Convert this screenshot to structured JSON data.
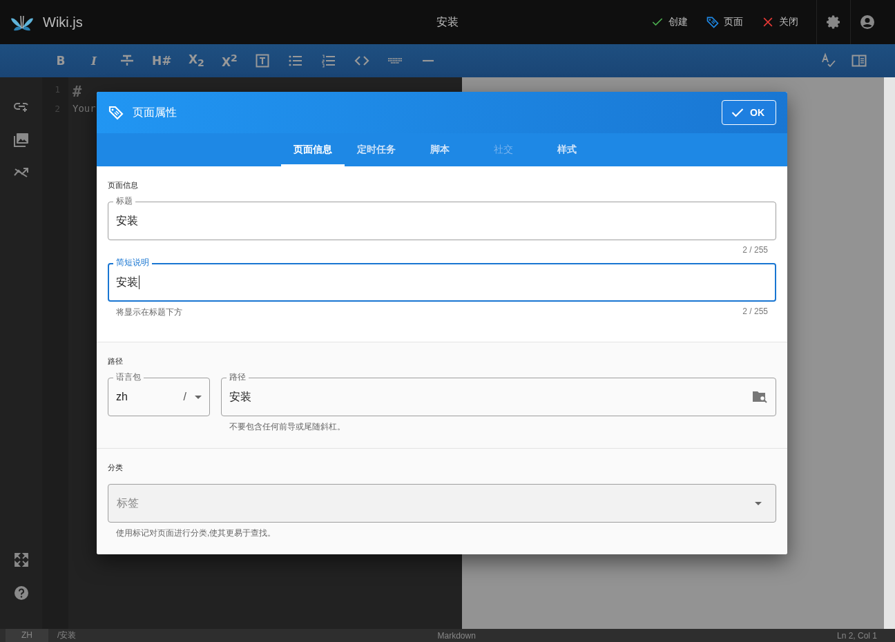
{
  "app_bar": {
    "logo_text": "Wiki.js",
    "title": "安装",
    "actions": [
      {
        "kind": "create",
        "label": "创建"
      },
      {
        "kind": "page",
        "label": "页面"
      },
      {
        "kind": "close",
        "label": "关闭"
      }
    ]
  },
  "toolbar": {
    "tools": [
      {
        "kind": "bold",
        "label": "B"
      },
      {
        "kind": "italic",
        "label": "I"
      },
      {
        "kind": "strike"
      },
      {
        "kind": "heading",
        "label": "H#"
      },
      {
        "kind": "subscript",
        "label": "X$_{2}$"
      },
      {
        "kind": "superscript",
        "label": "X$^{2}$"
      },
      {
        "kind": "box"
      },
      {
        "kind": "list"
      },
      {
        "kind": "olist"
      },
      {
        "kind": "code"
      },
      {
        "kind": "keyboard"
      },
      {
        "kind": "rule"
      }
    ]
  },
  "editor": {
    "line_numbers": [
      "1",
      "2"
    ],
    "lines": [
      "#",
      "Your"
    ]
  },
  "dialog": {
    "title": "页面属性",
    "ok_label": "OK",
    "tabs": [
      {
        "label": "页面信息",
        "selected": true,
        "disabled": false
      },
      {
        "label": "定时任务",
        "selected": false,
        "disabled": false
      },
      {
        "label": "脚本",
        "selected": false,
        "disabled": false
      },
      {
        "label": "社交",
        "selected": false,
        "disabled": true
      },
      {
        "label": "样式",
        "selected": false,
        "disabled": false
      }
    ],
    "info": {
      "heading": "页面信息",
      "title_field": {
        "label": "标题",
        "value": "安装",
        "counter": "2 / 255",
        "focused": false
      },
      "description_field": {
        "label": "简短说明",
        "value": "安装",
        "hint": "将显示在标题下方",
        "counter": "2 / 255",
        "focused": true
      }
    },
    "path": {
      "heading": "路径",
      "locale_field": {
        "label": "语言包",
        "value": "zh",
        "separator": "/"
      },
      "path_field": {
        "label": "路径",
        "value": "安装",
        "hint": "不要包含任何前导或尾随斜杠。"
      }
    },
    "categories": {
      "heading": "分类",
      "tags_field": {
        "placeholder": "标签",
        "hint": "使用标记对页面进行分类,使其更易于查找。"
      }
    }
  },
  "status_bar": {
    "locale": "ZH",
    "path": "/安装",
    "mode": "Markdown",
    "position": "Ln 2, Col 1"
  }
}
